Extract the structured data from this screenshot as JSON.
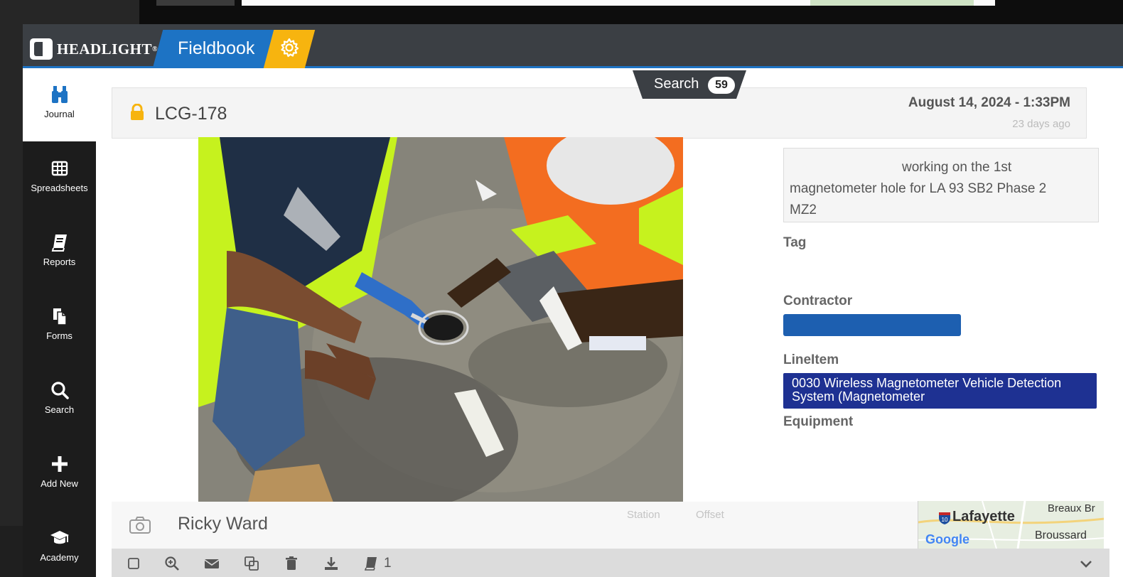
{
  "brand": {
    "name": "HEADLIGHT",
    "tm": "®",
    "app": "Fieldbook"
  },
  "colors": {
    "accent_blue": "#1d73c4",
    "accent_yellow": "#f7b40f",
    "lineitem_bg": "#1e3192",
    "contractor_bg": "#1d5fb0"
  },
  "sidebar": {
    "items": [
      {
        "label": "Journal",
        "icon": "binoculars-icon",
        "active": true
      },
      {
        "label": "Spreadsheets",
        "icon": "grid-icon",
        "active": false
      },
      {
        "label": "Reports",
        "icon": "book-icon",
        "active": false
      },
      {
        "label": "Forms",
        "icon": "copy-icon",
        "active": false
      },
      {
        "label": "Search",
        "icon": "search-icon",
        "active": false
      },
      {
        "label": "Add New",
        "icon": "plus-icon",
        "active": false
      },
      {
        "label": "Academy",
        "icon": "graduation-cap-icon",
        "active": false
      }
    ]
  },
  "search_tab": {
    "label": "Search",
    "count": "59"
  },
  "record": {
    "id": "LCG-178",
    "date": "August 14, 2024 - 1:33PM",
    "ago": "23 days ago",
    "note_line1": "working on the 1st",
    "note_line2": "magnetometer hole for LA 93  SB2 Phase 2",
    "note_line3": "MZ2",
    "author": "Ricky Ward"
  },
  "fields": {
    "tag_label": "Tag",
    "contractor_label": "Contractor",
    "lineitem_label": "LineItem",
    "lineitem_line1": "0030 Wireless Magnetometer Vehicle Detection",
    "lineitem_line2": "System (Magnetometer",
    "equipment_label": "Equipment",
    "station_label": "Station",
    "offset_label": "Offset"
  },
  "map": {
    "city": "Lafayette",
    "breaux": "Breaux Br",
    "broussard": "Broussard",
    "provider": "Google",
    "highway": "10"
  },
  "toolbar": {
    "icons": [
      "checkbox-icon",
      "zoom-in-icon",
      "envelope-icon",
      "duplicate-icon",
      "trash-icon",
      "download-icon",
      "report-book-icon",
      "chevron-down-icon"
    ],
    "report_count": "1"
  }
}
